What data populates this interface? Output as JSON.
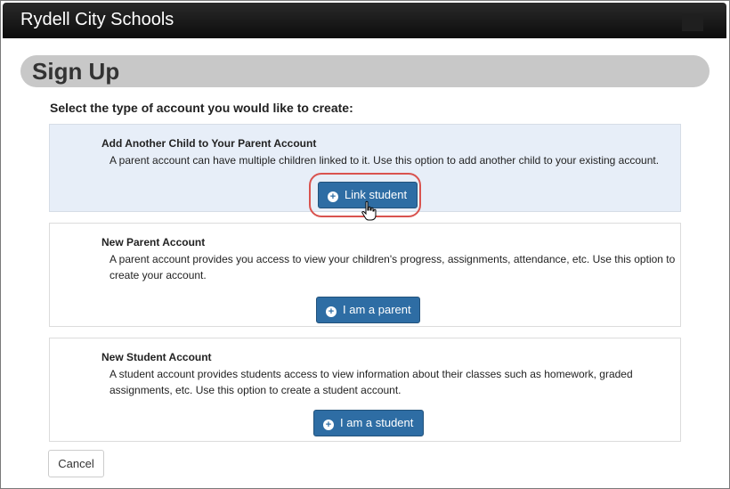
{
  "app": {
    "title": "Rydell City Schools"
  },
  "page": {
    "heading": "Sign Up",
    "prompt": "Select the type of account you would like to create:"
  },
  "options": [
    {
      "title": "Add Another Child to Your Parent Account",
      "description": "A parent account can have multiple children linked to it. Use this option to add another child to your existing account.",
      "button_label": "Link student"
    },
    {
      "title": "New Parent Account",
      "description": "A parent account provides you access to view your children's progress, assignments, attendance, etc. Use this option to create your account.",
      "button_label": "I am a parent"
    },
    {
      "title": "New Student Account",
      "description": "A student account provides students access to view information about their classes such as homework, graded assignments, etc. Use this option to create a student account.",
      "button_label": "I am a student"
    }
  ],
  "footer": {
    "cancel_label": "Cancel"
  },
  "colors": {
    "primary_button": "#2e6da4",
    "highlight_ring": "#d9534f",
    "selected_panel": "#e7eef8"
  },
  "icons": {
    "button_icon": "plus-circle-icon",
    "cursor": "hand-pointer-icon"
  }
}
